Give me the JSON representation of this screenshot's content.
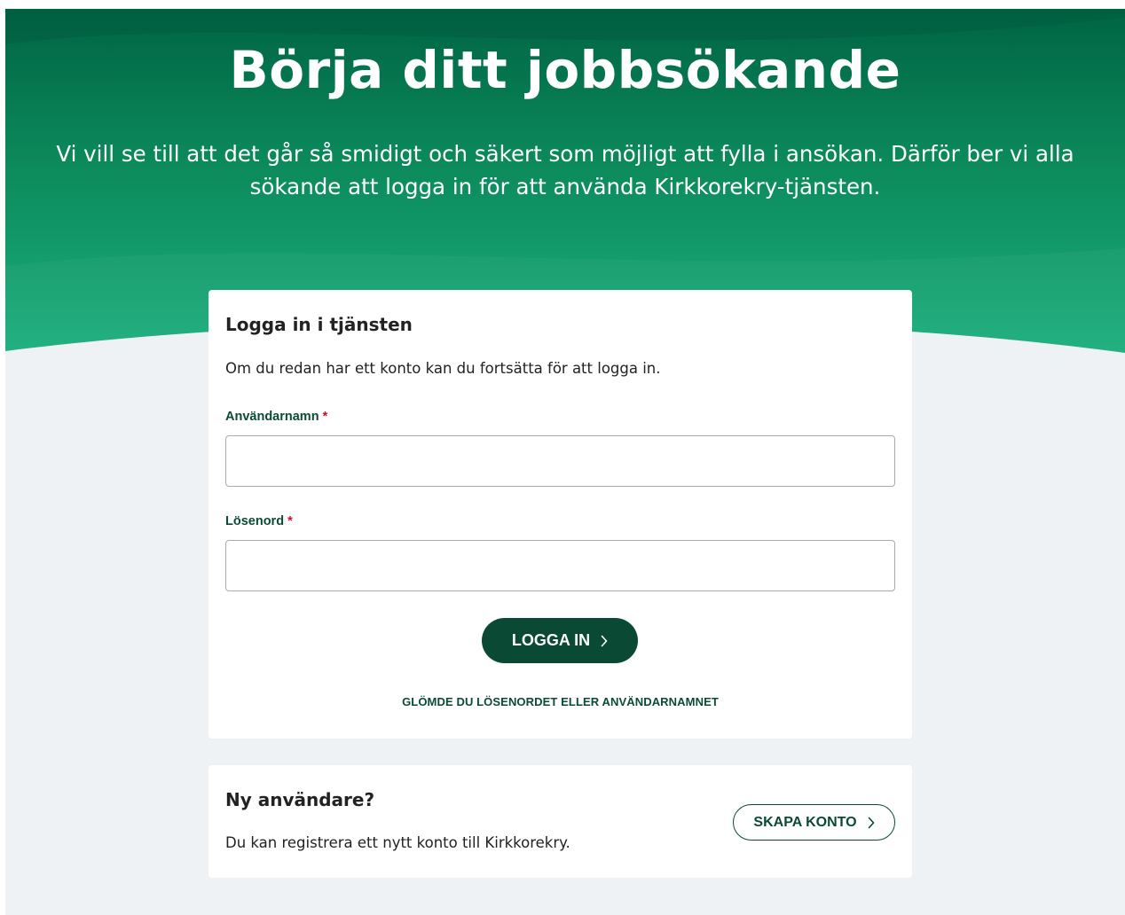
{
  "hero": {
    "title": "Börja ditt jobbsökande",
    "subtitle": "Vi vill se till att det går så smidigt och säkert som möjligt att fylla i ansökan. Därför ber vi alla sökande att logga in för att använda Kirkkorekry-tjänsten."
  },
  "login": {
    "heading": "Logga in i tjänsten",
    "intro": "Om du redan har ett konto kan du fortsätta för att logga in.",
    "username_label": "Användarnamn",
    "username_value": "",
    "password_label": "Lösenord",
    "password_value": "",
    "required_marker": "*",
    "submit_label": "LOGGA IN",
    "forgot_label": "GLÖMDE DU LÖSENORDET ELLER ANVÄNDARNAMNET"
  },
  "new_user": {
    "heading": "Ny användare?",
    "text": "Du kan registrera ett nytt konto till Kirkkorekry.",
    "create_label": "SKAPA KONTO"
  },
  "icons": {
    "login_chevron": "chevron-right-icon",
    "create_chevron": "chevron-right-icon"
  },
  "colors": {
    "hero_dark": "#006443",
    "hero_light": "#1aae7c",
    "primary": "#0a4a34",
    "background": "#eef2f4",
    "required": "#c8102e"
  }
}
